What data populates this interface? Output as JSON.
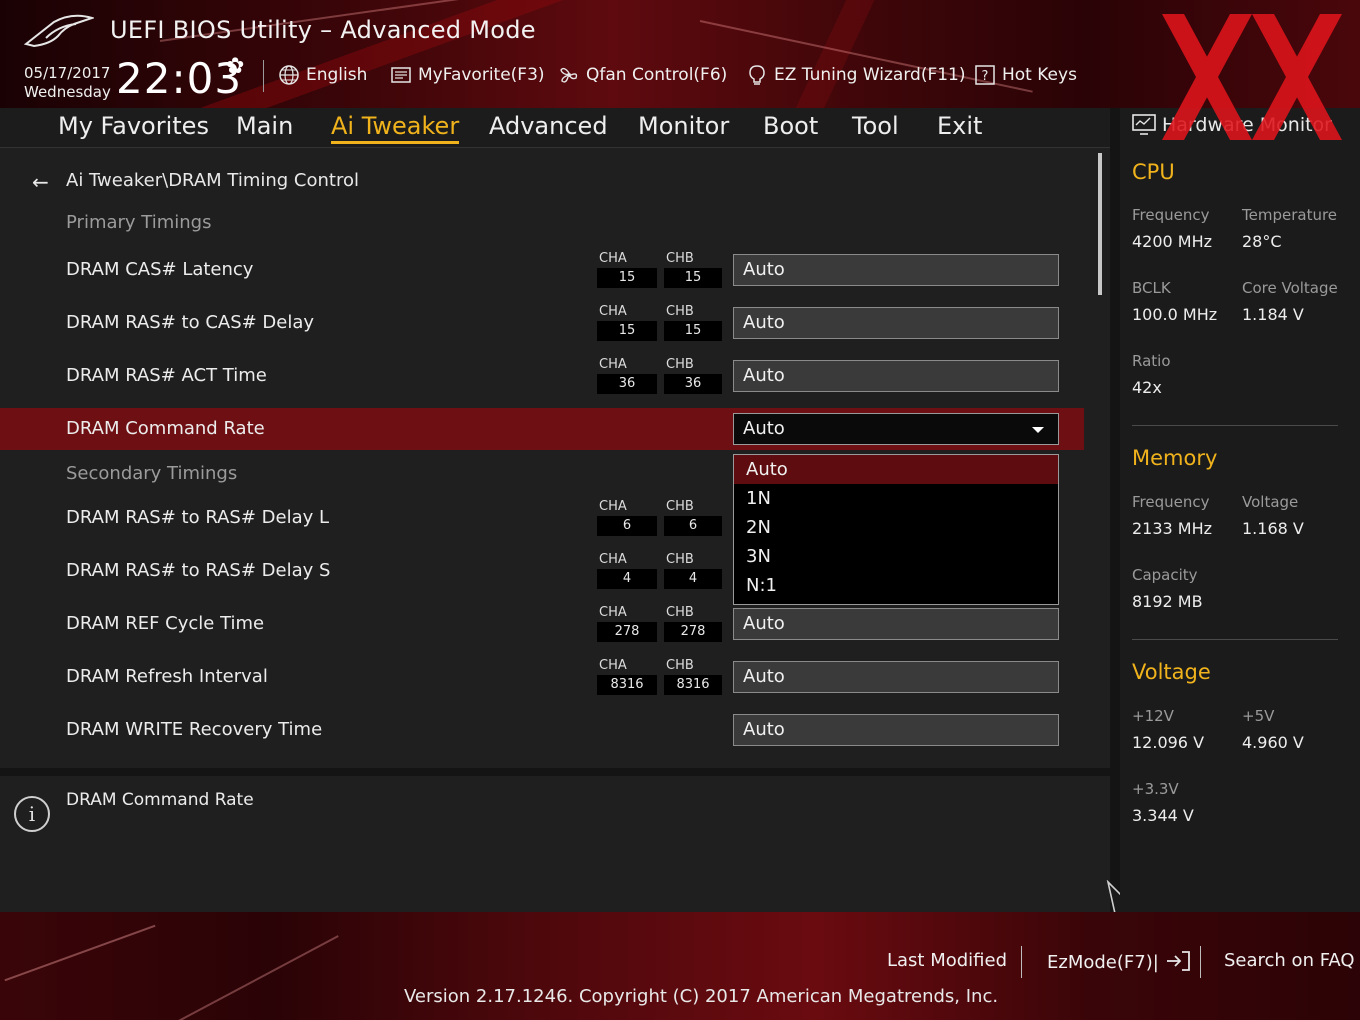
{
  "header": {
    "title": "UEFI BIOS Utility – Advanced Mode",
    "date": "05/17/2017",
    "weekday": "Wednesday",
    "time": "22:03",
    "tools": [
      {
        "label": "English",
        "icon": "globe-icon"
      },
      {
        "label": "MyFavorite(F3)",
        "icon": "favorite-icon"
      },
      {
        "label": "Qfan Control(F6)",
        "icon": "fan-icon"
      },
      {
        "label": "EZ Tuning Wizard(F11)",
        "icon": "lightbulb-icon"
      },
      {
        "label": "Hot Keys",
        "icon": "help-box-icon"
      }
    ]
  },
  "nav": {
    "items": [
      "My Favorites",
      "Main",
      "Ai Tweaker",
      "Advanced",
      "Monitor",
      "Boot",
      "Tool",
      "Exit"
    ],
    "active": "Ai Tweaker"
  },
  "main": {
    "breadcrumb": "Ai Tweaker\\DRAM Timing Control",
    "primary_heading": "Primary Timings",
    "secondary_heading": "Secondary Timings",
    "rows": [
      {
        "label": "DRAM CAS# Latency",
        "cha_label": "CHA",
        "chb_label": "CHB",
        "cha": "15",
        "chb": "15",
        "value": "Auto"
      },
      {
        "label": "DRAM RAS# to CAS# Delay",
        "cha_label": "CHA",
        "chb_label": "CHB",
        "cha": "15",
        "chb": "15",
        "value": "Auto"
      },
      {
        "label": "DRAM RAS# ACT Time",
        "cha_label": "CHA",
        "chb_label": "CHB",
        "cha": "36",
        "chb": "36",
        "value": "Auto"
      },
      {
        "label": "DRAM Command Rate",
        "value": "Auto"
      },
      {
        "label": "DRAM RAS# to RAS# Delay L",
        "cha_label": "CHA",
        "chb_label": "CHB",
        "cha": "6",
        "chb": "6"
      },
      {
        "label": "DRAM RAS# to RAS# Delay S",
        "cha_label": "CHA",
        "chb_label": "CHB",
        "cha": "4",
        "chb": "4"
      },
      {
        "label": "DRAM REF Cycle Time",
        "cha_label": "CHA",
        "chb_label": "CHB",
        "cha": "278",
        "chb": "278",
        "value": "Auto"
      },
      {
        "label": "DRAM Refresh Interval",
        "cha_label": "CHA",
        "chb_label": "CHB",
        "cha": "8316",
        "chb": "8316",
        "value": "Auto"
      },
      {
        "label": "DRAM WRITE Recovery Time",
        "value": "Auto"
      }
    ],
    "dropdown_options": [
      "Auto",
      "1N",
      "2N",
      "3N",
      "N:1"
    ],
    "dropdown_selected": "Auto"
  },
  "help": {
    "text": "DRAM Command Rate"
  },
  "hw_monitor": {
    "title": "Hardware Monitor",
    "cpu": {
      "heading": "CPU",
      "frequency_label": "Frequency",
      "frequency": "4200 MHz",
      "temperature_label": "Temperature",
      "temperature": "28°C",
      "bclk_label": "BCLK",
      "bclk": "100.0 MHz",
      "core_voltage_label": "Core Voltage",
      "core_voltage": "1.184 V",
      "ratio_label": "Ratio",
      "ratio": "42x"
    },
    "memory": {
      "heading": "Memory",
      "frequency_label": "Frequency",
      "frequency": "2133 MHz",
      "voltage_label": "Voltage",
      "voltage": "1.168 V",
      "capacity_label": "Capacity",
      "capacity": "8192 MB"
    },
    "voltage": {
      "heading": "Voltage",
      "v12_label": "+12V",
      "v12": "12.096 V",
      "v5_label": "+5V",
      "v5": "4.960 V",
      "v33_label": "+3.3V",
      "v33": "3.344 V"
    }
  },
  "footer": {
    "last_modified": "Last Modified",
    "ezmode": "EzMode(F7)|",
    "search": "Search on FAQ",
    "version": "Version 2.17.1246. Copyright (C) 2017 American Megatrends, Inc."
  },
  "colors": {
    "accent": "#f1b31c",
    "selected_row": "#6e1013",
    "brand_red": "#e0141c"
  }
}
